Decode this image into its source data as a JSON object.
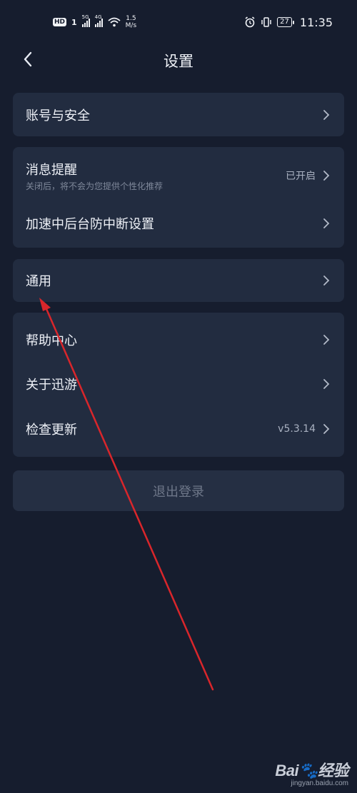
{
  "status_bar": {
    "hd": "HD",
    "sim1": "1",
    "net1": "5G",
    "net2": "4G",
    "speed_value": "1.5",
    "speed_unit": "M/s",
    "battery": "27",
    "time": "11:35"
  },
  "header": {
    "title": "设置"
  },
  "groups": {
    "account": {
      "label": "账号与安全"
    },
    "notify": {
      "label": "消息提醒",
      "sub": "关闭后，将不会为您提供个性化推荐",
      "value": "已开启"
    },
    "background": {
      "label": "加速中后台防中断设置"
    },
    "general": {
      "label": "通用"
    },
    "help": {
      "label": "帮助中心"
    },
    "about": {
      "label": "关于迅游"
    },
    "update": {
      "label": "检查更新",
      "value": "v5.3.14"
    }
  },
  "logout": {
    "label": "退出登录"
  },
  "watermark": {
    "brand": "Bai",
    "brand_tail": "经验",
    "url": "jingyan.baidu.com"
  },
  "colors": {
    "background": "#161d2e",
    "card": "#222c40",
    "annotation_arrow": "#d9262b"
  }
}
